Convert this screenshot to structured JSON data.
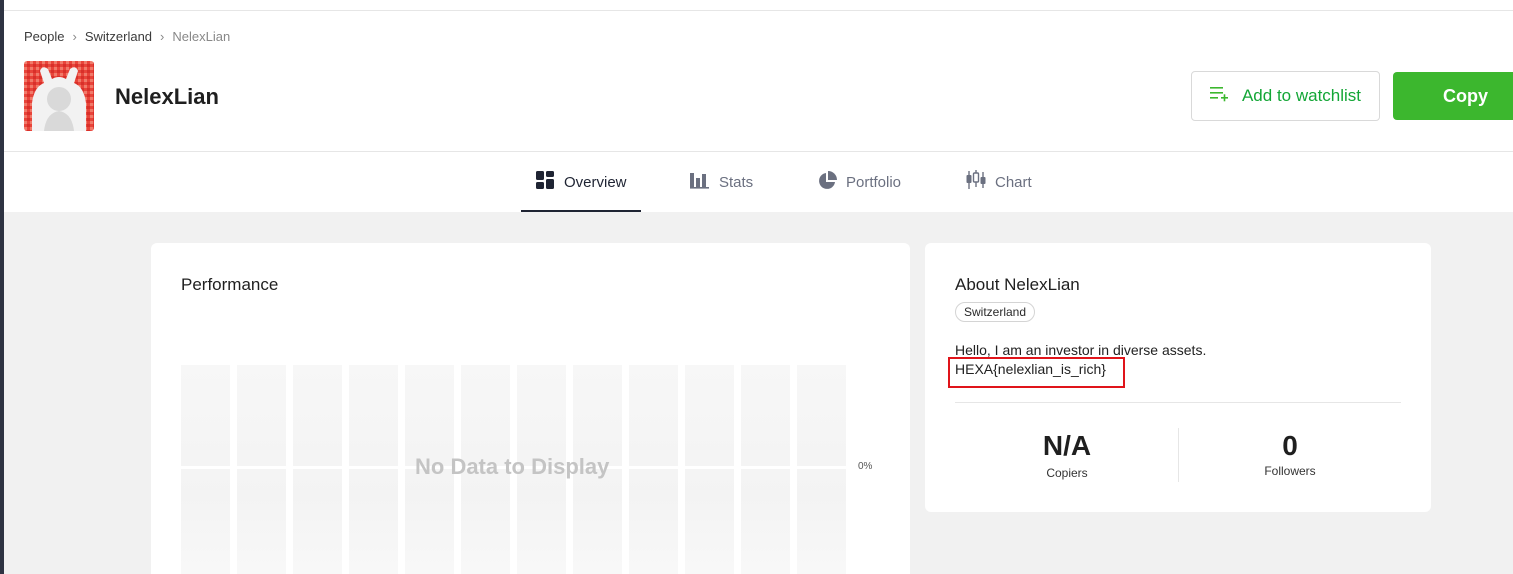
{
  "breadcrumb": {
    "items": [
      "People",
      "Switzerland",
      "NelexLian"
    ]
  },
  "profile": {
    "username": "NelexLian"
  },
  "actions": {
    "watchlist_label": "Add to watchlist",
    "copy_label": "Copy"
  },
  "tabs": [
    {
      "label": "Overview",
      "icon": "grid-icon",
      "active": true
    },
    {
      "label": "Stats",
      "icon": "bar-chart-icon",
      "active": false
    },
    {
      "label": "Portfolio",
      "icon": "pie-chart-icon",
      "active": false
    },
    {
      "label": "Chart",
      "icon": "candlestick-icon",
      "active": false
    }
  ],
  "performance": {
    "title": "Performance",
    "empty_text": "No Data to Display",
    "axis_value": "0%"
  },
  "about": {
    "title": "About NelexLian",
    "country": "Switzerland",
    "bio_line1": "Hello, I am an investor in diverse assets.",
    "bio_line2": "HEXA{nelexlian_is_rich}",
    "copiers_value": "N/A",
    "copiers_label": "Copiers",
    "followers_value": "0",
    "followers_label": "Followers"
  },
  "colors": {
    "accent_green": "#3cb72e",
    "highlight_red": "#e0141a",
    "background_gray": "#f1f1f1"
  }
}
